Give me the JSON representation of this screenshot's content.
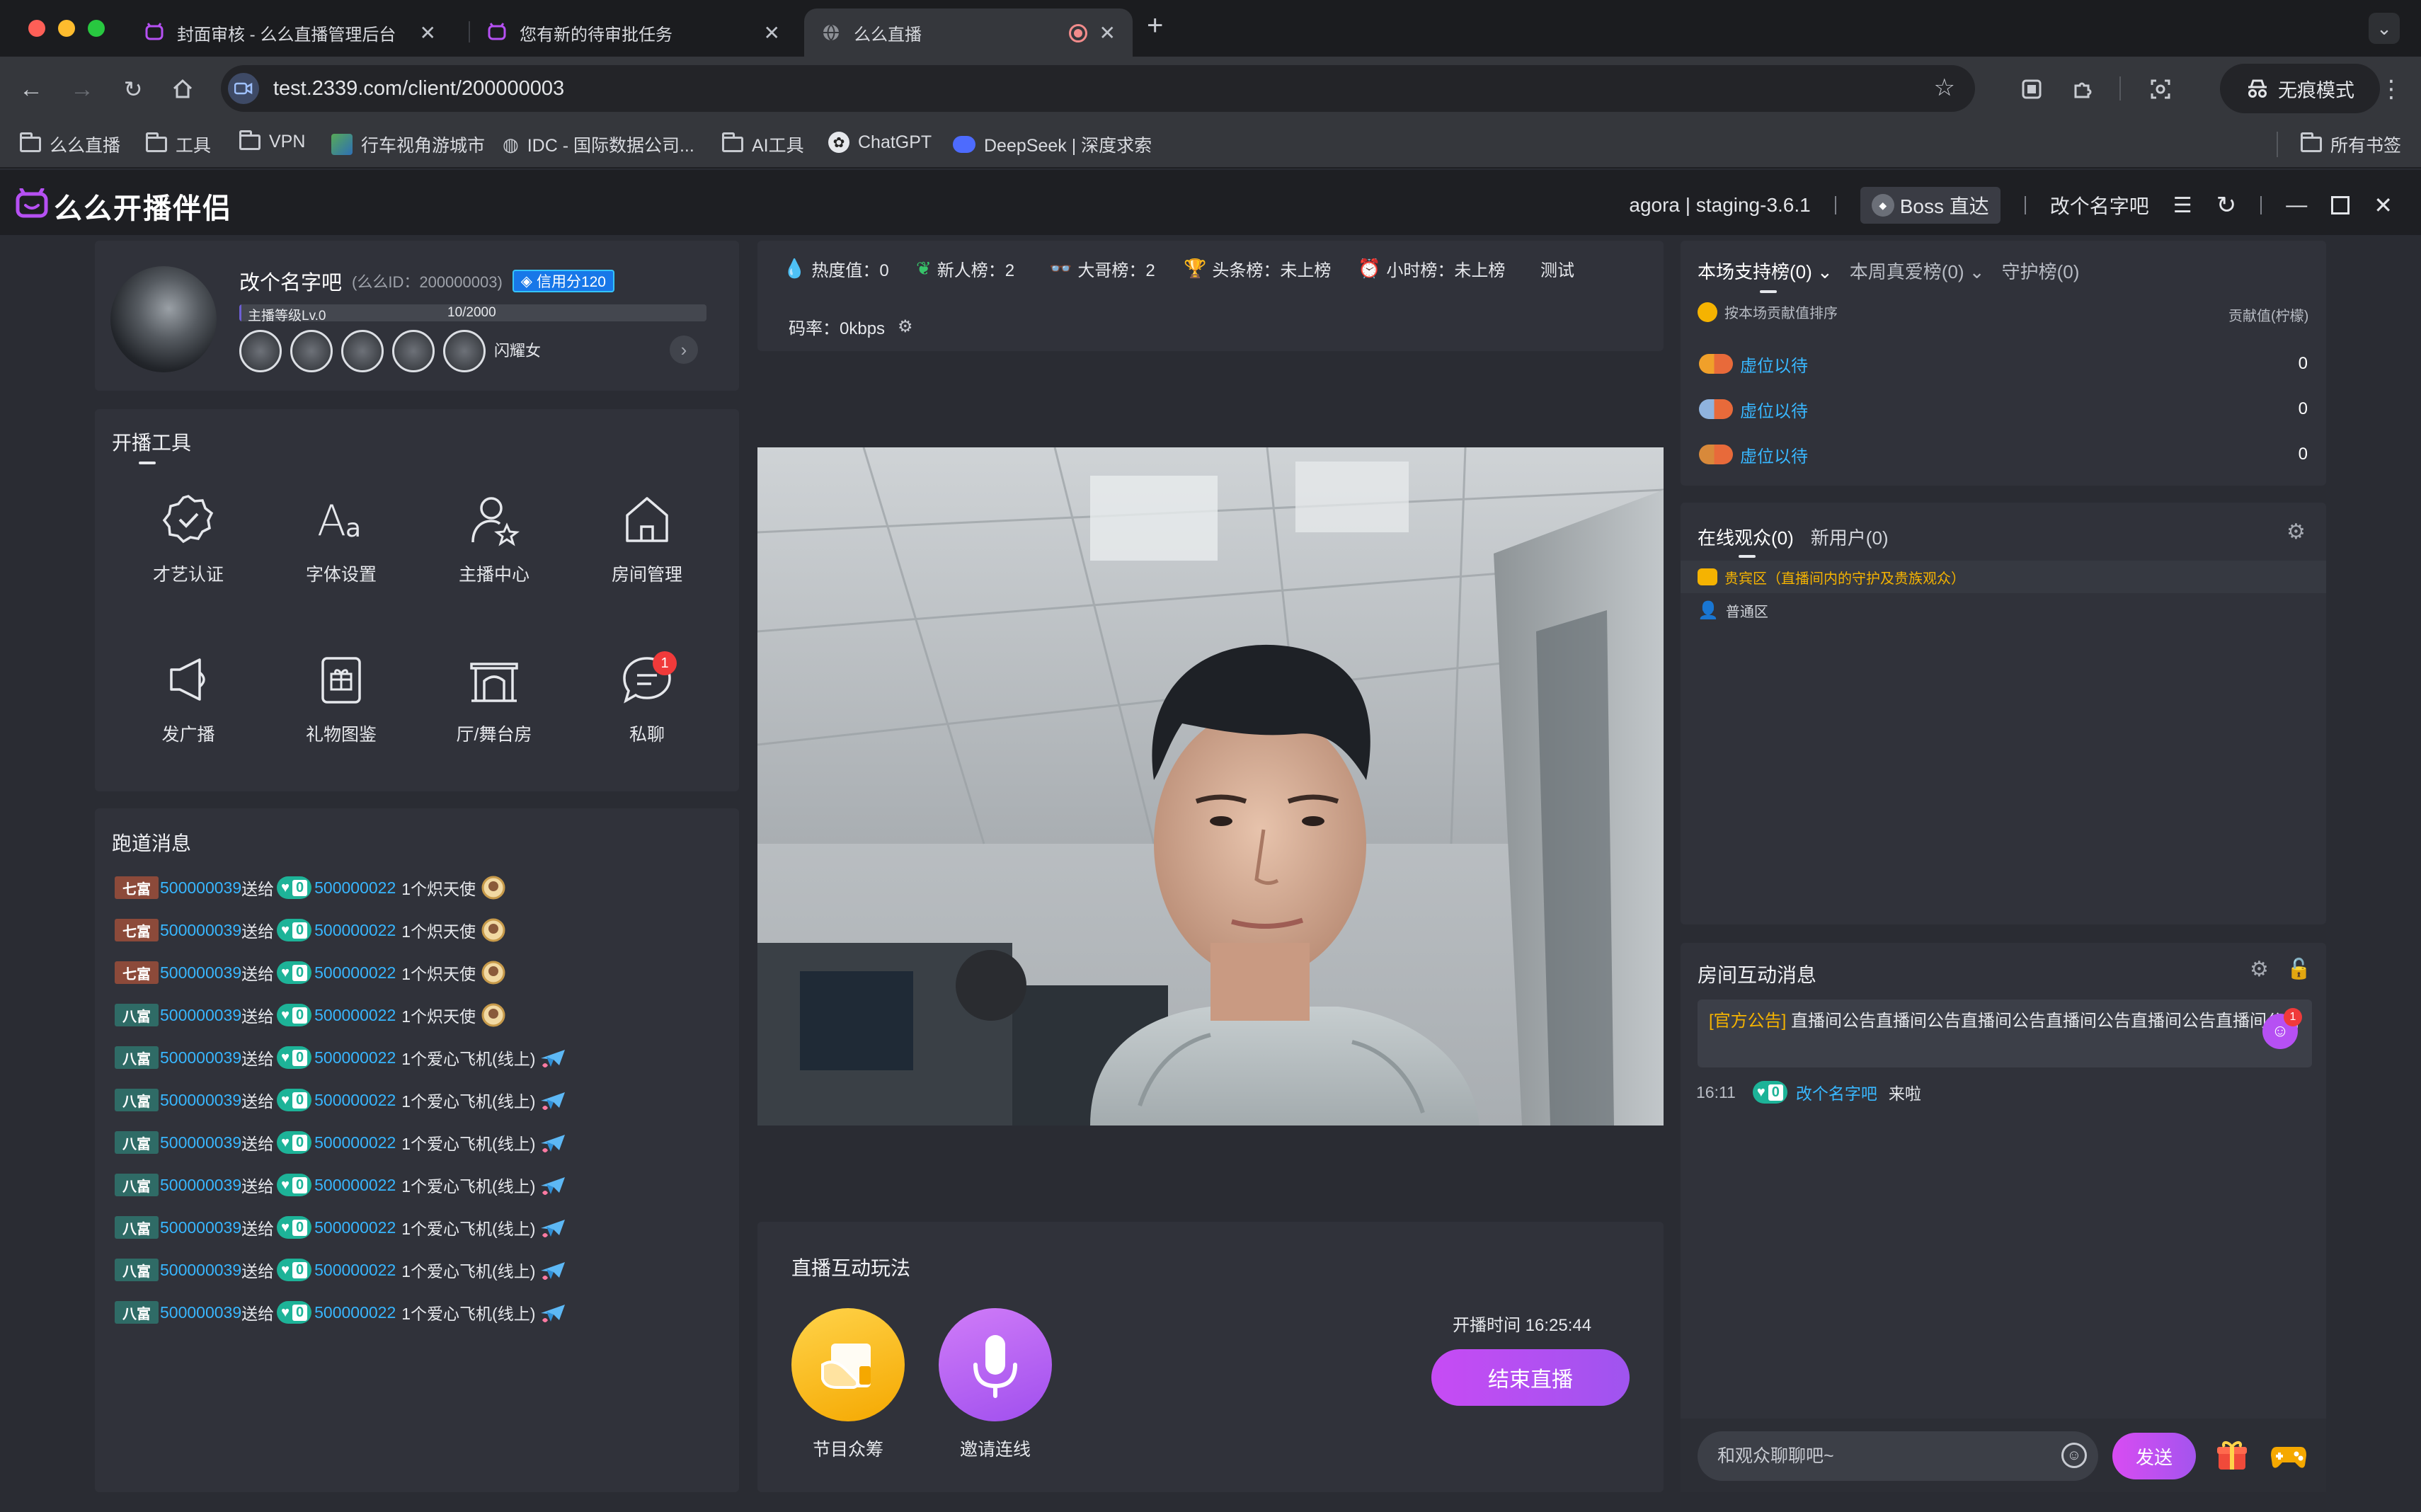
{
  "browser": {
    "tabs": [
      {
        "title": "封面审核 - 么么直播管理后台",
        "active": false
      },
      {
        "title": "您有新的待审批任务",
        "active": false
      },
      {
        "title": "么么直播",
        "active": true
      }
    ],
    "url": "test.2339.com/client/200000003",
    "incognito_label": "无痕模式",
    "bookmarks": [
      "么么直播",
      "工具",
      "VPN",
      "行车视角游城市",
      "IDC - 国际数据公司...",
      "AI工具",
      "ChatGPT",
      "DeepSeek | 深度求索"
    ],
    "all_bookmarks": "所有书签"
  },
  "app": {
    "title": "么么开播伴侣",
    "version_label": "agora | staging-3.6.1",
    "boss_label": "Boss 直达",
    "user_name": "改个名字吧"
  },
  "profile": {
    "name": "改个名字吧",
    "id_label": "(么么ID：200000003)",
    "credit_label": "信用分120",
    "level_label": "主播等级Lv.0",
    "level_progress_text": "10/2000",
    "level_progress": 0.005,
    "badge_alt_text": "闪耀女"
  },
  "tools": {
    "title": "开播工具",
    "items": [
      {
        "label": "才艺认证",
        "icon": "badge-check-icon"
      },
      {
        "label": "字体设置",
        "icon": "font-icon"
      },
      {
        "label": "主播中心",
        "icon": "user-star-icon"
      },
      {
        "label": "房间管理",
        "icon": "house-icon"
      },
      {
        "label": "发广播",
        "icon": "megaphone-icon"
      },
      {
        "label": "礼物图鉴",
        "icon": "gift-box-icon"
      },
      {
        "label": "厅/舞台房",
        "icon": "stage-icon"
      },
      {
        "label": "私聊",
        "icon": "chat-icon",
        "badge": "1"
      }
    ]
  },
  "broadcast": {
    "title": "跑道消息",
    "rows": [
      {
        "rank": "七富",
        "from": "500000039",
        "verb": "送给",
        "level": "0",
        "to": "500000022",
        "gift": "1个炽天使"
      },
      {
        "rank": "七富",
        "from": "500000039",
        "verb": "送给",
        "level": "0",
        "to": "500000022",
        "gift": "1个炽天使"
      },
      {
        "rank": "七富",
        "from": "500000039",
        "verb": "送给",
        "level": "0",
        "to": "500000022",
        "gift": "1个炽天使"
      },
      {
        "rank": "八富",
        "from": "500000039",
        "verb": "送给",
        "level": "0",
        "to": "500000022",
        "gift": "1个炽天使"
      },
      {
        "rank": "八富",
        "from": "500000039",
        "verb": "送给",
        "level": "0",
        "to": "500000022",
        "gift": "1个爱心飞机(线上)"
      },
      {
        "rank": "八富",
        "from": "500000039",
        "verb": "送给",
        "level": "0",
        "to": "500000022",
        "gift": "1个爱心飞机(线上)"
      },
      {
        "rank": "八富",
        "from": "500000039",
        "verb": "送给",
        "level": "0",
        "to": "500000022",
        "gift": "1个爱心飞机(线上)"
      },
      {
        "rank": "八富",
        "from": "500000039",
        "verb": "送给",
        "level": "0",
        "to": "500000022",
        "gift": "1个爱心飞机(线上)"
      },
      {
        "rank": "八富",
        "from": "500000039",
        "verb": "送给",
        "level": "0",
        "to": "500000022",
        "gift": "1个爱心飞机(线上)"
      },
      {
        "rank": "八富",
        "from": "500000039",
        "verb": "送给",
        "level": "0",
        "to": "500000022",
        "gift": "1个爱心飞机(线上)"
      },
      {
        "rank": "八富",
        "from": "500000039",
        "verb": "送给",
        "level": "0",
        "to": "500000022",
        "gift": "1个爱心飞机(线上)"
      }
    ]
  },
  "stats": {
    "heat": "热度值：0",
    "newbie": "新人榜：2",
    "bigbro": "大哥榜：2",
    "headline": "头条榜：未上榜",
    "hourly": "小时榜：未上榜",
    "test": "测试",
    "bitrate": "码率：0kbps"
  },
  "interactive": {
    "title": "直播互动玩法",
    "items": [
      {
        "label": "节目众筹",
        "icon": "hand-card-icon",
        "color": "#f7b300"
      },
      {
        "label": "邀请连线",
        "icon": "microphone-icon",
        "color": "#b15cf2"
      }
    ],
    "live_time": "开播时间 16:25:44",
    "end_button": "结束直播"
  },
  "support_rank": {
    "tabs": [
      "本场支持榜(0)",
      "本周真爱榜(0)",
      "守护榜(0)"
    ],
    "sort_label": "按本场贡献值排序",
    "value_header": "贡献值(柠檬)",
    "rows": [
      {
        "name": "虚位以待",
        "value": "0",
        "medal_color": "#f0a02a"
      },
      {
        "name": "虚位以待",
        "value": "0",
        "medal_color": "#8fb3de"
      },
      {
        "name": "虚位以待",
        "value": "0",
        "medal_color": "#d8893a"
      }
    ]
  },
  "audience": {
    "tabs": [
      "在线观众(0)",
      "新用户(0)"
    ],
    "vip_label": "贵宾区（直播间内的守护及贵族观众）",
    "normal_label": "普通区"
  },
  "room_chat": {
    "title": "房间互动消息",
    "notice_tag": "[官方公告]",
    "notice_text": "直播间公告直播间公告直播间公告直播间公告直播间公告直播间公告",
    "notice_badge": "1",
    "messages": [
      {
        "time": "16:11",
        "level": "0",
        "user": "改个名字吧",
        "text": "来啦"
      }
    ],
    "input_placeholder": "和观众聊聊吧~",
    "send_label": "发送"
  },
  "colors": {
    "accent_purple": "#b650f3",
    "link_blue": "#38b7ff",
    "gold": "#f5b301",
    "panel_bg": "#30323a",
    "page_bg": "#2a2c33"
  }
}
